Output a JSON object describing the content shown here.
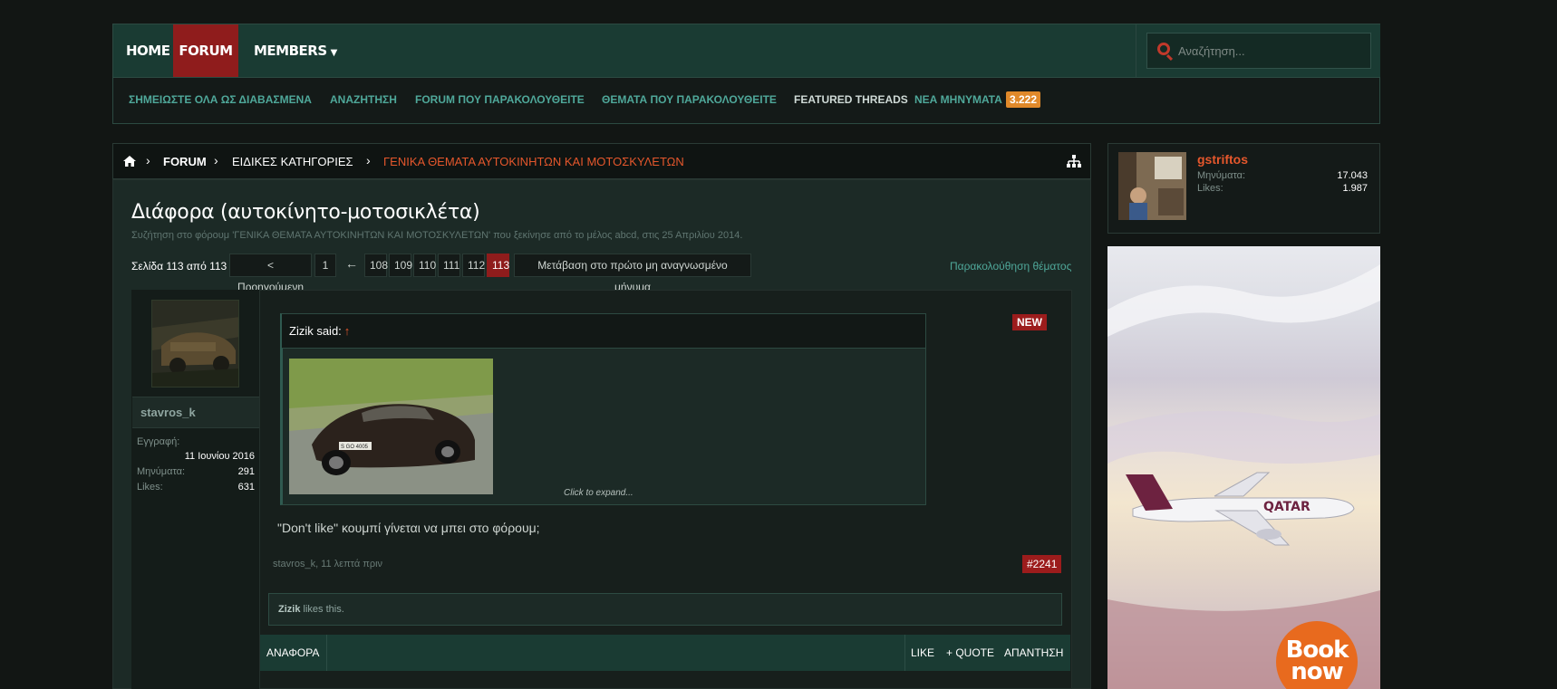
{
  "nav": {
    "home": "HOME",
    "forum": "FORUM",
    "members": "MEMBERS",
    "search_placeholder": "Αναζήτηση..."
  },
  "subnav": {
    "items": [
      "ΣΗΜΕΙΩΣΤΕ ΟΛΑ ΩΣ ΔΙΑΒΑΣΜΕΝΑ",
      "ΑΝΑΖΗΤΗΣΗ",
      "FORUM ΠΟΥ ΠΑΡΑΚΟΛΟΥΘΕΙΤΕ",
      "ΘΕΜΑΤΑ ΠΟΥ ΠΑΡΑΚΟΛΟΥΘΕΙΤΕ",
      "FEATURED THREADS",
      "ΝΕΑ ΜΗΝΥΜΑΤΑ"
    ],
    "new_count": "3.222"
  },
  "breadcrumb": {
    "items": [
      "FORUM",
      "ΕΙΔΙΚΕΣ ΚΑΤΗΓΟΡΙΕΣ",
      "ΓΕΝΙΚΑ ΘΕΜΑΤΑ ΑΥΤΟΚΙΝΗΤΩΝ ΚΑΙ ΜΟΤΟΣΚΥΛΕΤΩΝ"
    ]
  },
  "thread": {
    "title": "Διάφορα (αυτοκίνητο-μοτοσικλέτα)",
    "subtitle": "Συζήτηση στο φόρουμ 'ΓΕΝΙΚΑ ΘΕΜΑΤΑ ΑΥΤΟΚΙΝΗΤΩΝ ΚΑΙ ΜΟΤΟΣΚΥΛΕΤΩΝ' που ξεκίνησε από το μέλος abcd, στις 25 Απριλίου 2014.",
    "watch": "Παρακολούθηση θέματος"
  },
  "pagination": {
    "info": "Σελίδα 113 από 113",
    "prev": "< Προηγούμενη",
    "first": "1",
    "arrow": "←",
    "pages": [
      "108",
      "109",
      "110",
      "111",
      "112",
      "113"
    ],
    "current": "113",
    "jump": "Μετάβαση στο πρώτο μη αναγνωσμένο μήνυμα"
  },
  "post": {
    "username": "stavros_k",
    "user_info": [
      {
        "label": "Εγγραφή:",
        "value": "11 Ιουνίου 2016"
      },
      {
        "label": "Μηνύματα:",
        "value": "291"
      },
      {
        "label": "Likes:",
        "value": "631"
      }
    ],
    "new_badge": "NEW",
    "quote_author": "Zizik said:",
    "quote_arrow": "↑",
    "quote_plate": "S GO 4005",
    "expand": "Click to expand...",
    "text": "\"Don't like\" κουμπί γίνεται να μπει στο φόρουμ;",
    "meta": "stavros_k, 11 λεπτά πριν",
    "number": "#2241",
    "likes_user": "Zizik",
    "likes_rest": " likes this.",
    "actions": {
      "report": "ΑΝΑΦΟΡΑ",
      "like": "LIKE",
      "quote": "+ QUOTE",
      "reply": "ΑΠΑΝΤΗΣΗ"
    }
  },
  "visitor": {
    "name": "gstriftos",
    "messages_label": "Μηνύματα:",
    "messages": "17.043",
    "likes_label": "Likes:",
    "likes": "1.987"
  },
  "ad": {
    "airline": "QATAR",
    "cta_line1": "Book",
    "cta_line2": "now"
  }
}
